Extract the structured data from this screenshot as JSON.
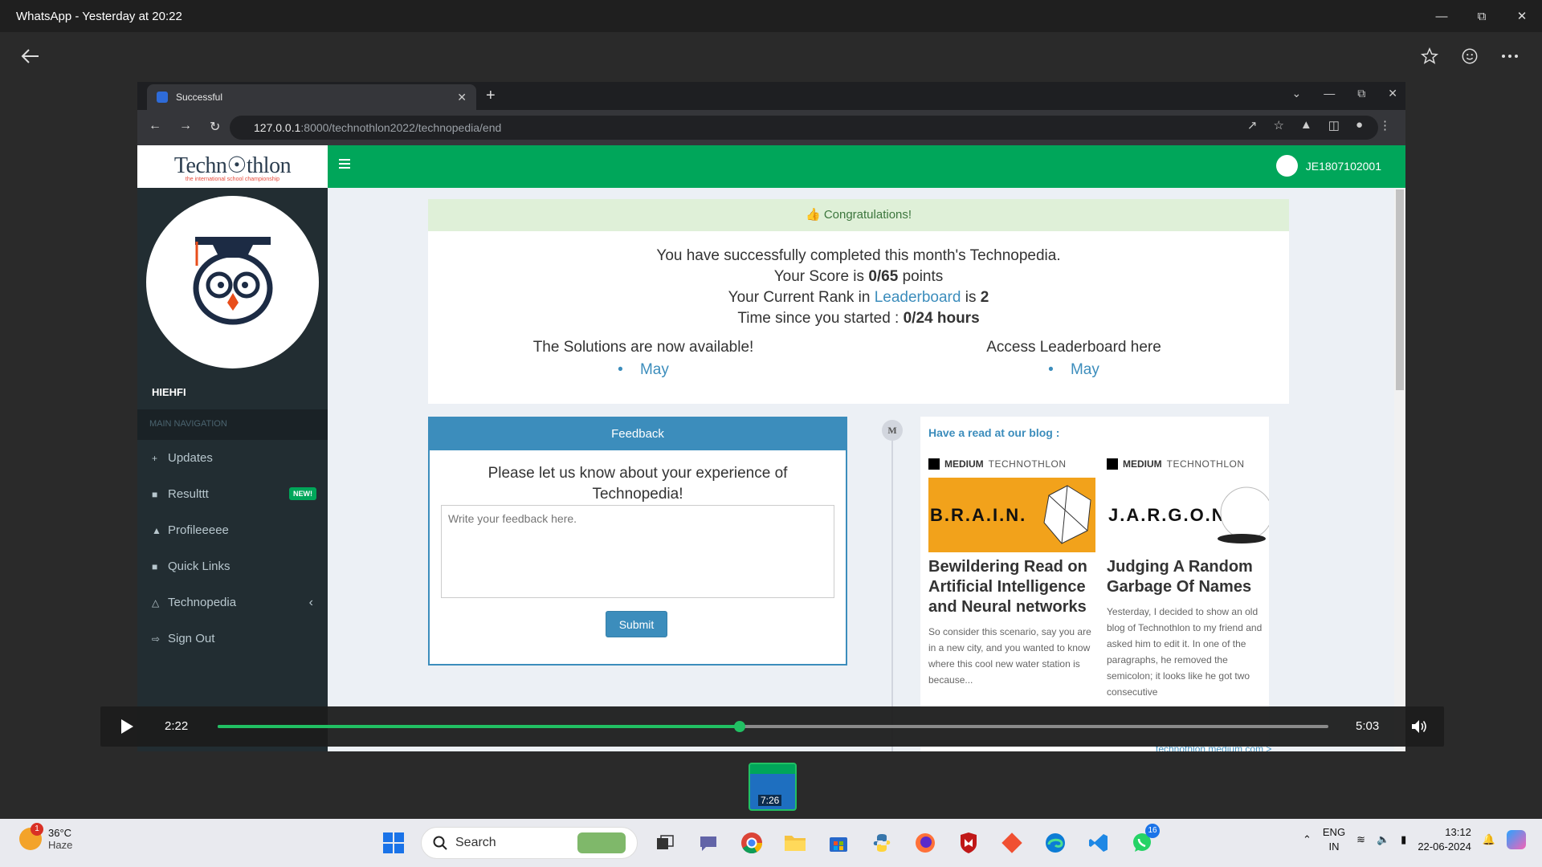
{
  "window": {
    "title": "WhatsApp - Yesterday at 20:22"
  },
  "browser": {
    "tab_title": "Successful",
    "url_host": "127.0.0.1",
    "url_path": ":8000/technothlon2022/technopedia/end"
  },
  "site": {
    "logo": "Techn☉thlon",
    "logo_tagline": "the international school championship",
    "user_name": "HIEHFI",
    "user_id": "JE1807102001",
    "nav_header": "MAIN NAVIGATION",
    "nav": [
      {
        "label": "Updates",
        "icon": "+"
      },
      {
        "label": "Resulttt",
        "icon": "■",
        "badge": "NEW!"
      },
      {
        "label": "Profileeeee",
        "icon": "▲"
      },
      {
        "label": "Quick Links",
        "icon": "■"
      },
      {
        "label": "Technopedia",
        "icon": "△",
        "chevron": "‹"
      },
      {
        "label": "Sign Out",
        "icon": "⇨"
      }
    ]
  },
  "congrats": {
    "header": "Congratulations!",
    "line1": "You have successfully completed this month's Technopedia.",
    "score_prefix": "Your Score is ",
    "score": "0/65",
    "score_suffix": " points",
    "rank_prefix": "Your Current Rank in ",
    "rank_link": "Leaderboard",
    "rank_mid": " is ",
    "rank": "2",
    "time_prefix": "Time since you started : ",
    "time": "0/24 hours",
    "solutions_label": "The Solutions are now available!",
    "solutions_link": "May",
    "leaderboard_label": "Access Leaderboard here",
    "leaderboard_link": "May"
  },
  "feedback": {
    "header": "Feedback",
    "question": "Please let us know about your experience of Technopedia!",
    "placeholder": "Write your feedback here.",
    "submit": "Submit"
  },
  "blog": {
    "heading": "Have a read at our blog :",
    "marker": "M",
    "source": "MEDIUM",
    "publisher": "TECHNOTHLON",
    "cards": [
      {
        "image_word": "B.R.A.I.N.",
        "title": "Bewildering Read on Artificial Intelligence and Neural networks",
        "excerpt": "So consider this scenario, say you are in a new city, and you wanted to know where this cool new water station is because..."
      },
      {
        "image_word": "J.A.R.G.O.N",
        "title": "Judging A Random Garbage Of Names",
        "excerpt": "Yesterday, I decided to show an old blog of Technothlon to my friend and asked him to edit it. In one of the paragraphs, he removed the semicolon; it looks like he got two consecutive"
      }
    ],
    "footer_link": "technothlon.medium.com >"
  },
  "video": {
    "current_time": "2:22",
    "total_time": "5:03",
    "progress": 0.47,
    "thumb_duration": "7:26",
    "accent": "#21c063"
  },
  "taskbar": {
    "weather_temp": "36°C",
    "weather_desc": "Haze",
    "weather_badge": "1",
    "search": "Search",
    "lang1": "ENG",
    "lang2": "IN",
    "time": "13:12",
    "date": "22-06-2024",
    "whatsapp_badge": "16"
  },
  "colors": {
    "adminlte_green": "#00a65a",
    "adminlte_blue": "#3c8dbc",
    "sidebar": "#222d32"
  }
}
